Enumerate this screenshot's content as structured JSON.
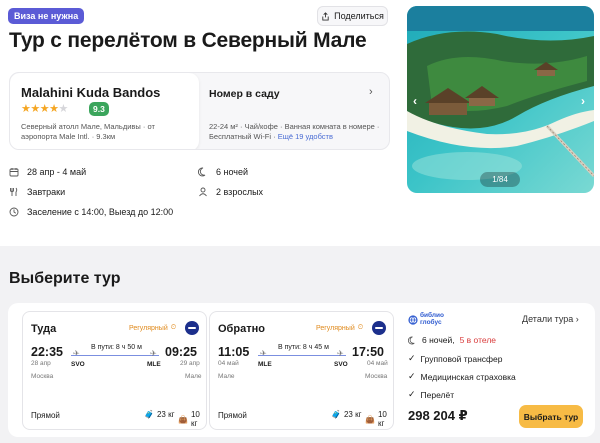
{
  "header": {
    "badge": "Виза не нужна",
    "share_label": "Поделиться",
    "title": "Тур с перелётом в Северный Мале"
  },
  "photo": {
    "counter": "1/84",
    "prev": "‹",
    "next": "›"
  },
  "hotel": {
    "name": "Malahini Kuda Bandos",
    "stars": 4,
    "stars_total": 5,
    "rating": "9.3",
    "address": "Северный атолл Мале, Мальдивы · от аэропорта Male Intl. · 9.3км"
  },
  "room": {
    "title": "Номер в саду",
    "info": "22-24 м² · Чай/кофе · Ванная комната в номере · Бесплатный Wi-Fi · ",
    "more_link": "Ещё 19 удобств"
  },
  "facts": {
    "dates": "28 апр - 4 май",
    "nights": "6 ночей",
    "meals": "Завтраки",
    "guests": "2 взрослых",
    "checkin": "Заселение с 14:00, Выезд до 12:00"
  },
  "section_title": "Выберите тур",
  "outbound": {
    "title": "Туда",
    "tag": "Регулярный",
    "dep_time": "22:35",
    "dep_date": "28 апр",
    "dep_city": "Москва",
    "dep_code": "SVO",
    "duration": "В пути: 8 ч 50 м",
    "arr_code": "MLE",
    "arr_time": "09:25",
    "arr_date": "29 апр",
    "arr_city": "Мале",
    "direct": "Прямой",
    "bag_checked": "23 кг",
    "bag_hand": "10 кг"
  },
  "inbound": {
    "title": "Обратно",
    "tag": "Регулярный",
    "dep_time": "11:05",
    "dep_date": "04 май",
    "dep_city": "Мале",
    "dep_code": "MLE",
    "duration": "В пути: 8 ч 45 м",
    "arr_code": "SVO",
    "arr_time": "17:50",
    "arr_date": "04 май",
    "arr_city": "Москва",
    "direct": "Прямой",
    "bag_checked": "23 кг",
    "bag_hand": "10 кг"
  },
  "offer": {
    "operator": "библио глобус",
    "details_link": "Детали тура",
    "nights": "6 ночей,",
    "hotel_warn": "5 в отеле",
    "transfer": "Групповой трансфер",
    "insurance": "Медицинская страховка",
    "flight": "Перелёт",
    "price": "298 204 ₽",
    "choose_button": "Выбрать тур"
  },
  "colors": {
    "badge": "#5b5bd6",
    "rating": "#3ba55c",
    "button": "#f7bb45",
    "warning": "#d93b3b",
    "link": "#4a6cd4"
  }
}
